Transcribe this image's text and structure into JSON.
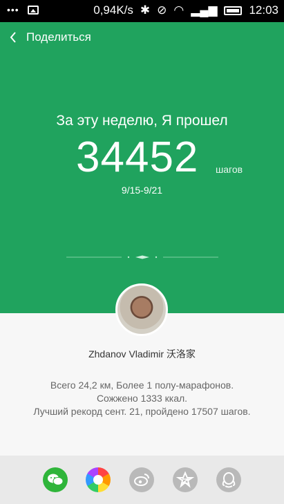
{
  "status_bar": {
    "network_speed": "0,94K/s",
    "time": "12:03"
  },
  "header": {
    "back_label": "Поделиться"
  },
  "summary": {
    "headline": "За эту неделю, Я прошел",
    "steps": "34452",
    "unit": "шагов",
    "date_range": "9/15-9/21"
  },
  "profile": {
    "name": "Zhdanov Vladimir 沃洛家"
  },
  "stats": {
    "line1": "Всего 24,2 км, Более 1 полу-марафонов.",
    "line2": "Сожжено 1333 ккал.",
    "line3": "Лучший рекорд сент. 21, пройдено 17507 шагов."
  },
  "share_targets": [
    "wechat-icon",
    "moments-icon",
    "weibo-icon",
    "qzone-icon",
    "qq-icon"
  ],
  "colors": {
    "accent": "#20a35e",
    "share_bar": "#e9e9e9"
  }
}
